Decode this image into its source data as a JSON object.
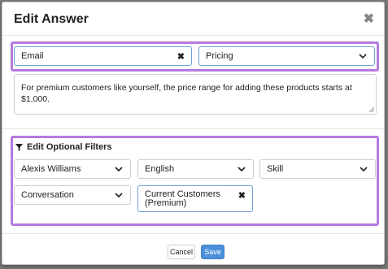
{
  "modal": {
    "title": "Edit Answer",
    "close_glyph": "✖"
  },
  "answer": {
    "channel": {
      "value": "Email",
      "clear_glyph": "✖"
    },
    "topic": {
      "value": "Pricing"
    },
    "text": "For premium customers like yourself, the price range for adding these products starts at $1,000."
  },
  "filters": {
    "title": "Edit Optional Filters",
    "icon": "filter-icon",
    "agent": {
      "value": "Alexis Williams"
    },
    "language": {
      "value": "English"
    },
    "skill": {
      "value": "Skill"
    },
    "type": {
      "value": "Conversation"
    },
    "segment": {
      "value": "Current Customers (Premium)",
      "clear_glyph": "✖"
    }
  },
  "footer": {
    "cancel_label": "Cancel",
    "save_label": "Save"
  },
  "colors": {
    "highlight": "#b57bdf",
    "primary": "#4a90d9"
  }
}
